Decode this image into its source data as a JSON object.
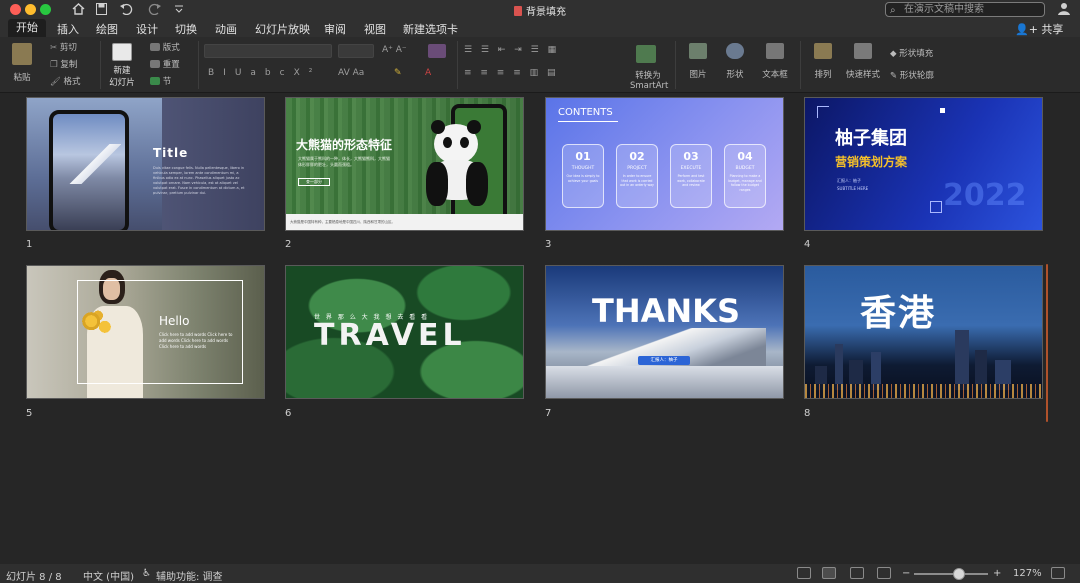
{
  "window": {
    "title": "背景填充",
    "search_placeholder": "在演示文稿中搜索"
  },
  "tabs": [
    "开始",
    "插入",
    "绘图",
    "设计",
    "切换",
    "动画",
    "幻灯片放映",
    "审阅",
    "视图",
    "新建选项卡"
  ],
  "share_label": "共享",
  "ribbon": {
    "paste": "粘贴",
    "cut": "剪切",
    "copy": "复制",
    "format": "格式",
    "new_slide_line1": "新建",
    "new_slide_line2": "幻灯片",
    "layout": "版式",
    "reset": "重置",
    "section": "节",
    "convert_smartart_line1": "转换为",
    "convert_smartart_line2": "SmartArt",
    "picture": "图片",
    "shapes": "形状",
    "textbox": "文本框",
    "arrange": "排列",
    "quick_styles": "快速样式",
    "shape_fill": "形状填充",
    "shape_outline": "形状轮廓"
  },
  "slides": [
    {
      "number": "1",
      "title": "Title",
      "body": "Duis vitae congue felis. Nulla pellentesque, libero in vehicula semper, lorem ante condimentum mi, a finibus odio ex at nunc. Phasellus aliquet justo ac volutpat ornare. Nam vehicula, est at aliquet vel volutpat erat. Fusce in condimentum at dictum a, et pulvinar, pretium pulvinar dui."
    },
    {
      "number": "2",
      "title": "大熊猫的形态特征",
      "body": "大熊猫属于熊科的一种，体长，大熊猫熊科，大熊猫体形胖胖的肥壮，头圆而颈粗。",
      "button": "查一部分",
      "caption": "大熊猫是中国特有种，主要栖息地是中国四川、陕西和甘肃的山区。"
    },
    {
      "number": "3",
      "heading": "CONTENTS",
      "cards": [
        {
          "num": "01",
          "label": "THOUGHT",
          "text": "Our idea is simply to achieve your goals"
        },
        {
          "num": "02",
          "label": "PROJECT",
          "text": "In order to ensure that work is carried out in an orderly way"
        },
        {
          "num": "03",
          "label": "EXECUTE",
          "text": "Perform and test work, collaborate and review"
        },
        {
          "num": "04",
          "label": "BUDGET",
          "text": "Planning to make a budget, manage and follow the budget ranges"
        }
      ]
    },
    {
      "number": "4",
      "title": "柚子集团",
      "subtitle": "营销策划方案",
      "meta": "汇报人：柚子",
      "sub_en": "SUBTITLE HERE",
      "year": "2022"
    },
    {
      "number": "5",
      "title": "Hello",
      "body": "Click here to add words Click here to add words Click here to add words Click here to add words"
    },
    {
      "number": "6",
      "title": "TRAVEL",
      "caption": "世  界  那  么  大    我  想  去  看  看"
    },
    {
      "number": "7",
      "title": "THANKS",
      "button": "汇报人：柚子"
    },
    {
      "number": "8",
      "title": "香港"
    }
  ],
  "status": {
    "slide_count": "幻灯片 8 / 8",
    "language": "中文 (中国)",
    "accessibility": "辅助功能: 调查",
    "zoom": "127%"
  },
  "zoom_level": 1.27
}
